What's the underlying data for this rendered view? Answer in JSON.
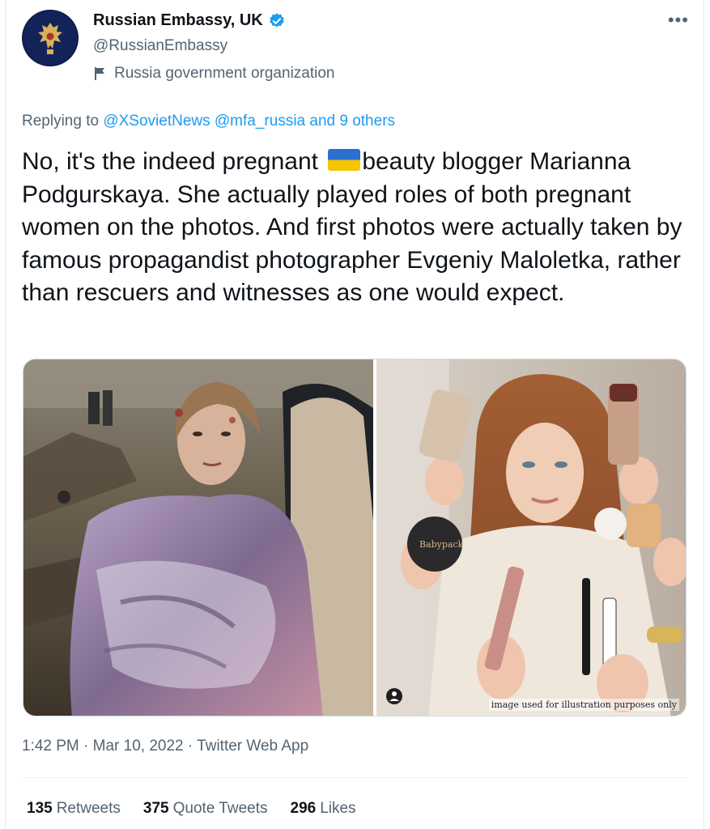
{
  "account": {
    "name": "Russian Embassy, UK",
    "handle": "@RussianEmbassy",
    "label": "Russia government organization",
    "more_label": "•••"
  },
  "reply": {
    "prefix": "Replying to ",
    "mentions": "@XSovietNews @mfa_russia and 9 others"
  },
  "tweet": {
    "text_before_flag": "No, it's the indeed pregnant ",
    "text_after_flag": "beauty blogger Marianna Podgurskaya. She actually played roles of both pregnant women on the photos. And first photos were actually taken by famous propagandist photographer Evgeniy Maloletka, rather than rescuers and witnesses as one would expect."
  },
  "media": {
    "caption": "image used for illustration purposes only",
    "left_photo": "woman-in-blanket-photo",
    "right_photo": "beauty-blogger-photo",
    "product_label": "Babypack"
  },
  "meta": {
    "time": "1:42 PM",
    "sep1": " · ",
    "date": "Mar 10, 2022",
    "sep2": " · ",
    "source": "Twitter Web App"
  },
  "stats": {
    "retweets_count": "135",
    "retweets_label": "Retweets",
    "quotes_count": "375",
    "quotes_label": "Quote Tweets",
    "likes_count": "296",
    "likes_label": "Likes"
  },
  "colors": {
    "link": "#1d9bf0",
    "secondary": "#536471",
    "flag_blue": "#2b6fd1",
    "flag_yellow": "#f5c400"
  }
}
